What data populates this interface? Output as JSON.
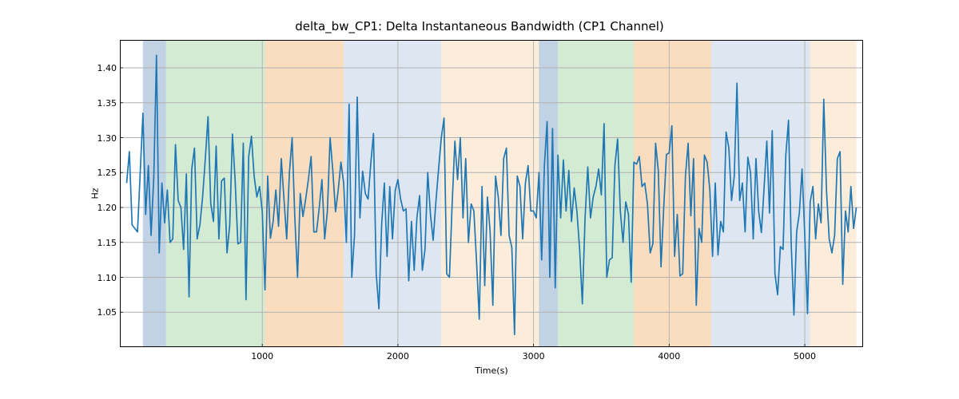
{
  "chart_data": {
    "type": "line",
    "title": "delta_bw_CP1: Delta Instantaneous Bandwidth (CP1 Channel)",
    "xlabel": "Time(s)",
    "ylabel": "Hz",
    "xlim": [
      -50,
      5430
    ],
    "ylim": [
      1.0,
      1.44
    ],
    "xticks": [
      1000,
      2000,
      3000,
      4000,
      5000
    ],
    "yticks": [
      1.05,
      1.1,
      1.15,
      1.2,
      1.25,
      1.3,
      1.35,
      1.4
    ],
    "grid": true,
    "line_color": "#1f77b4",
    "regions": [
      {
        "start": 120,
        "end": 290,
        "color": "#4a7fb3",
        "alpha": 0.35
      },
      {
        "start": 290,
        "end": 1020,
        "color": "#9ed19e",
        "alpha": 0.45
      },
      {
        "start": 1020,
        "end": 1600,
        "color": "#f5b371",
        "alpha": 0.45
      },
      {
        "start": 1600,
        "end": 2320,
        "color": "#b6c9e0",
        "alpha": 0.45
      },
      {
        "start": 2320,
        "end": 3040,
        "color": "#f8d5ad",
        "alpha": 0.45
      },
      {
        "start": 3040,
        "end": 3180,
        "color": "#4a7fb3",
        "alpha": 0.35
      },
      {
        "start": 3180,
        "end": 3740,
        "color": "#9ed19e",
        "alpha": 0.45
      },
      {
        "start": 3740,
        "end": 4310,
        "color": "#f5b371",
        "alpha": 0.45
      },
      {
        "start": 4310,
        "end": 5040,
        "color": "#b6c9e0",
        "alpha": 0.45
      },
      {
        "start": 5040,
        "end": 5380,
        "color": "#f8d5ad",
        "alpha": 0.45
      }
    ],
    "x": [
      0,
      20,
      40,
      60,
      80,
      100,
      120,
      140,
      160,
      180,
      200,
      220,
      240,
      260,
      280,
      300,
      320,
      340,
      360,
      380,
      400,
      420,
      440,
      460,
      480,
      500,
      520,
      540,
      560,
      580,
      600,
      620,
      640,
      660,
      680,
      700,
      720,
      740,
      760,
      780,
      800,
      820,
      840,
      860,
      880,
      900,
      920,
      940,
      960,
      980,
      1000,
      1020,
      1040,
      1060,
      1080,
      1100,
      1120,
      1140,
      1160,
      1180,
      1200,
      1220,
      1240,
      1260,
      1280,
      1300,
      1320,
      1340,
      1360,
      1380,
      1400,
      1420,
      1440,
      1460,
      1480,
      1500,
      1520,
      1540,
      1560,
      1580,
      1600,
      1620,
      1640,
      1660,
      1680,
      1700,
      1720,
      1740,
      1760,
      1780,
      1800,
      1820,
      1840,
      1860,
      1880,
      1900,
      1920,
      1940,
      1960,
      1980,
      2000,
      2020,
      2040,
      2060,
      2080,
      2100,
      2120,
      2140,
      2160,
      2180,
      2200,
      2220,
      2240,
      2260,
      2280,
      2300,
      2320,
      2340,
      2360,
      2380,
      2400,
      2420,
      2440,
      2460,
      2480,
      2500,
      2520,
      2540,
      2560,
      2580,
      2600,
      2620,
      2640,
      2660,
      2680,
      2700,
      2720,
      2740,
      2760,
      2780,
      2800,
      2820,
      2840,
      2860,
      2880,
      2900,
      2920,
      2940,
      2960,
      2980,
      3000,
      3020,
      3040,
      3060,
      3080,
      3100,
      3120,
      3140,
      3160,
      3180,
      3200,
      3220,
      3240,
      3260,
      3280,
      3300,
      3320,
      3340,
      3360,
      3380,
      3400,
      3420,
      3440,
      3460,
      3480,
      3500,
      3520,
      3540,
      3560,
      3580,
      3600,
      3620,
      3640,
      3660,
      3680,
      3700,
      3720,
      3740,
      3760,
      3780,
      3800,
      3820,
      3840,
      3860,
      3880,
      3900,
      3920,
      3940,
      3960,
      3980,
      4000,
      4020,
      4040,
      4060,
      4080,
      4100,
      4120,
      4140,
      4160,
      4180,
      4200,
      4220,
      4240,
      4260,
      4280,
      4300,
      4320,
      4340,
      4360,
      4380,
      4400,
      4420,
      4440,
      4460,
      4480,
      4500,
      4520,
      4540,
      4560,
      4580,
      4600,
      4620,
      4640,
      4660,
      4680,
      4700,
      4720,
      4740,
      4760,
      4780,
      4800,
      4820,
      4840,
      4860,
      4880,
      4900,
      4920,
      4940,
      4960,
      4980,
      5000,
      5020,
      5040,
      5060,
      5080,
      5100,
      5120,
      5140,
      5160,
      5180,
      5200,
      5220,
      5240,
      5260,
      5280,
      5300,
      5320,
      5340,
      5360,
      5380
    ],
    "values": [
      1.235,
      1.28,
      1.175,
      1.17,
      1.165,
      1.25,
      1.335,
      1.19,
      1.26,
      1.16,
      1.243,
      1.418,
      1.135,
      1.235,
      1.178,
      1.225,
      1.15,
      1.155,
      1.29,
      1.21,
      1.2,
      1.14,
      1.248,
      1.072,
      1.255,
      1.285,
      1.155,
      1.175,
      1.215,
      1.27,
      1.33,
      1.206,
      1.18,
      1.288,
      1.155,
      1.238,
      1.242,
      1.135,
      1.175,
      1.305,
      1.238,
      1.148,
      1.15,
      1.292,
      1.068,
      1.273,
      1.302,
      1.245,
      1.215,
      1.23,
      1.194,
      1.082,
      1.245,
      1.156,
      1.18,
      1.225,
      1.173,
      1.27,
      1.212,
      1.155,
      1.25,
      1.3,
      1.185,
      1.1,
      1.22,
      1.187,
      1.212,
      1.24,
      1.273,
      1.165,
      1.165,
      1.2,
      1.24,
      1.155,
      1.195,
      1.3,
      1.253,
      1.194,
      1.225,
      1.265,
      1.235,
      1.15,
      1.348,
      1.1,
      1.16,
      1.358,
      1.185,
      1.252,
      1.22,
      1.212,
      1.263,
      1.306,
      1.105,
      1.055,
      1.175,
      1.235,
      1.13,
      1.23,
      1.155,
      1.224,
      1.24,
      1.212,
      1.195,
      1.198,
      1.095,
      1.18,
      1.11,
      1.185,
      1.217,
      1.11,
      1.14,
      1.25,
      1.19,
      1.153,
      1.208,
      1.255,
      1.3,
      1.328,
      1.105,
      1.1,
      1.205,
      1.295,
      1.24,
      1.3,
      1.185,
      1.27,
      1.15,
      1.205,
      1.195,
      1.122,
      1.04,
      1.23,
      1.088,
      1.215,
      1.165,
      1.06,
      1.245,
      1.215,
      1.16,
      1.27,
      1.285,
      1.16,
      1.143,
      1.018,
      1.245,
      1.23,
      1.155,
      1.235,
      1.26,
      1.195,
      1.195,
      1.185,
      1.25,
      1.125,
      1.26,
      1.323,
      1.1,
      1.313,
      1.085,
      1.275,
      1.185,
      1.268,
      1.195,
      1.253,
      1.18,
      1.228,
      1.194,
      1.14,
      1.062,
      1.185,
      1.258,
      1.185,
      1.215,
      1.23,
      1.255,
      1.218,
      1.32,
      1.1,
      1.125,
      1.128,
      1.26,
      1.298,
      1.195,
      1.15,
      1.208,
      1.19,
      1.093,
      1.265,
      1.262,
      1.273,
      1.23,
      1.235,
      1.205,
      1.135,
      1.148,
      1.292,
      1.253,
      1.115,
      1.2,
      1.276,
      1.278,
      1.317,
      1.13,
      1.19,
      1.102,
      1.105,
      1.245,
      1.292,
      1.188,
      1.27,
      1.06,
      1.17,
      1.15,
      1.275,
      1.265,
      1.225,
      1.13,
      1.235,
      1.132,
      1.18,
      1.165,
      1.308,
      1.285,
      1.21,
      1.245,
      1.378,
      1.21,
      1.235,
      1.165,
      1.272,
      1.25,
      1.155,
      1.27,
      1.195,
      1.164,
      1.228,
      1.295,
      1.192,
      1.31,
      1.105,
      1.075,
      1.144,
      1.14,
      1.275,
      1.325,
      1.147,
      1.046,
      1.165,
      1.192,
      1.255,
      1.16,
      1.048,
      1.208,
      1.23,
      1.155,
      1.205,
      1.178,
      1.355,
      1.225,
      1.155,
      1.135,
      1.16,
      1.27,
      1.28,
      1.09,
      1.195,
      1.165,
      1.23,
      1.17,
      1.2
    ]
  }
}
